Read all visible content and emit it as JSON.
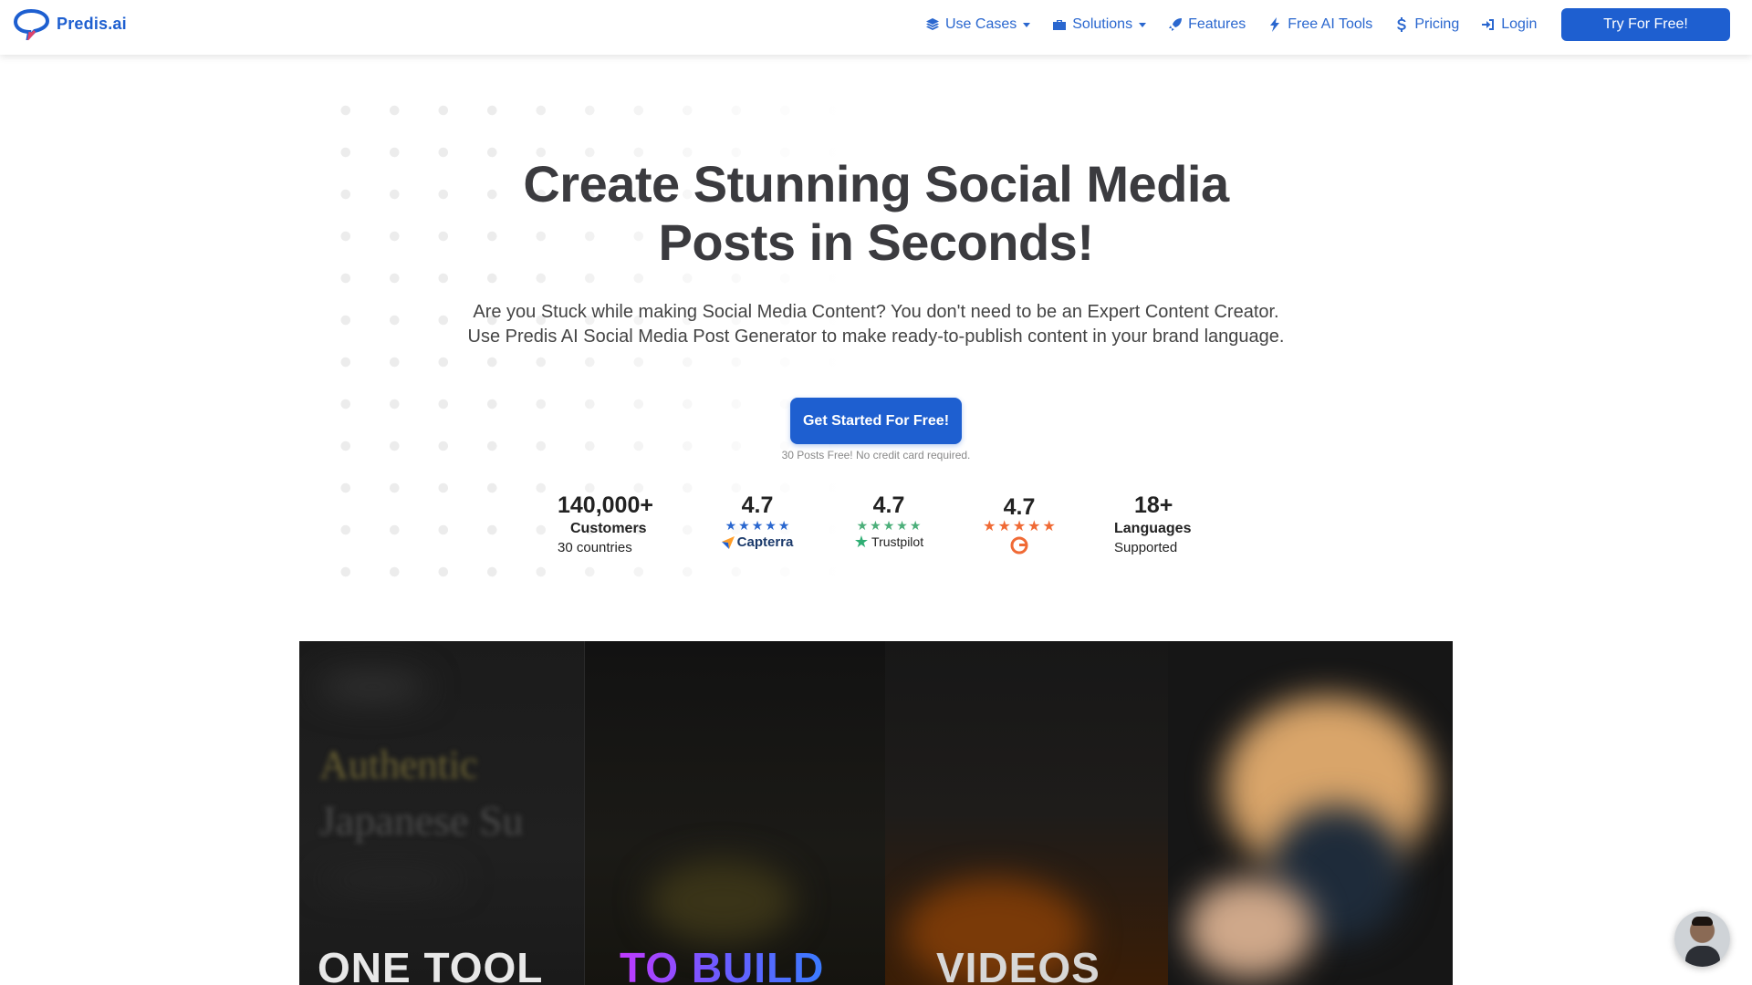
{
  "nav": {
    "logo_text": "Predis.ai",
    "items": [
      {
        "label": "Use Cases",
        "icon": "layers-icon",
        "dropdown": true
      },
      {
        "label": "Solutions",
        "icon": "briefcase-icon",
        "dropdown": true
      },
      {
        "label": "Features",
        "icon": "rocket-icon",
        "dropdown": false
      },
      {
        "label": "Free AI Tools",
        "icon": "bolt-icon",
        "dropdown": false
      },
      {
        "label": "Pricing",
        "icon": "dollar-icon",
        "dropdown": false
      },
      {
        "label": "Login",
        "icon": "sign-in-icon",
        "dropdown": false
      }
    ],
    "cta_label": "Try For Free!"
  },
  "hero": {
    "title_line1": "Create Stunning Social Media",
    "title_line2": "Posts in Seconds!",
    "subtitle_line1": "Are you Stuck while making Social Media Content? You don't need to be an Expert Content Creator.",
    "subtitle_line2": "Use Predis AI Social Media Post Generator to make ready-to-publish content in your brand language.",
    "cta_label": "Get Started For Free!",
    "cta_note": "30 Posts Free! No credit card required."
  },
  "stats": {
    "customers": {
      "value": "140,000+",
      "label": "Customers",
      "sub": "30 countries"
    },
    "capterra": {
      "value": "4.7",
      "brand": "Capterra",
      "stars": 5,
      "star_color": "#2a67cf"
    },
    "trustpilot": {
      "value": "4.7",
      "brand": "Trustpilot",
      "stars": 5,
      "star_color": "#4caf7a"
    },
    "g2": {
      "value": "4.7",
      "brand": "G",
      "stars": 5,
      "star_color": "#f06a35"
    },
    "languages": {
      "value": "18+",
      "label": "Languages",
      "sub": "Supported"
    }
  },
  "video": {
    "panel1_blur_title1": "Authentic",
    "panel1_blur_title2": "Japanese Su",
    "word1": "ONE TOOL",
    "word2": "TO BUILD",
    "word3": "VIDEOS"
  },
  "colors": {
    "brand_blue": "#1e5fd0",
    "heading": "#3b3b3f"
  }
}
